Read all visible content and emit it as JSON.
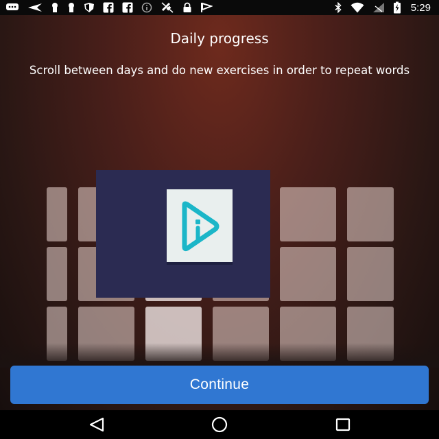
{
  "status_bar": {
    "left_icons": [
      "chat-icon",
      "send-icon",
      "keyhole-icon",
      "keyhole-icon",
      "shield-icon",
      "facebook-icon",
      "facebook-icon",
      "info-icon",
      "satellite-off-icon",
      "lock-icon",
      "flag-icon"
    ],
    "right_icons": [
      "bluetooth-icon",
      "wifi-icon",
      "signal-icon",
      "battery-charging-icon"
    ],
    "time": "5:29"
  },
  "onboarding": {
    "title": "Daily progress",
    "subtitle": "Scroll between days and do new exercises in order to repeat words"
  },
  "continue_button": {
    "label": "Continue"
  },
  "nav_bar": {
    "back_icon": "back-triangle-icon",
    "home_icon": "home-circle-icon",
    "recents_icon": "recents-square-icon"
  },
  "colors": {
    "button": "#3077d2",
    "logo_background": "#2b2b52",
    "logo_accent": "#1bb6c8"
  }
}
